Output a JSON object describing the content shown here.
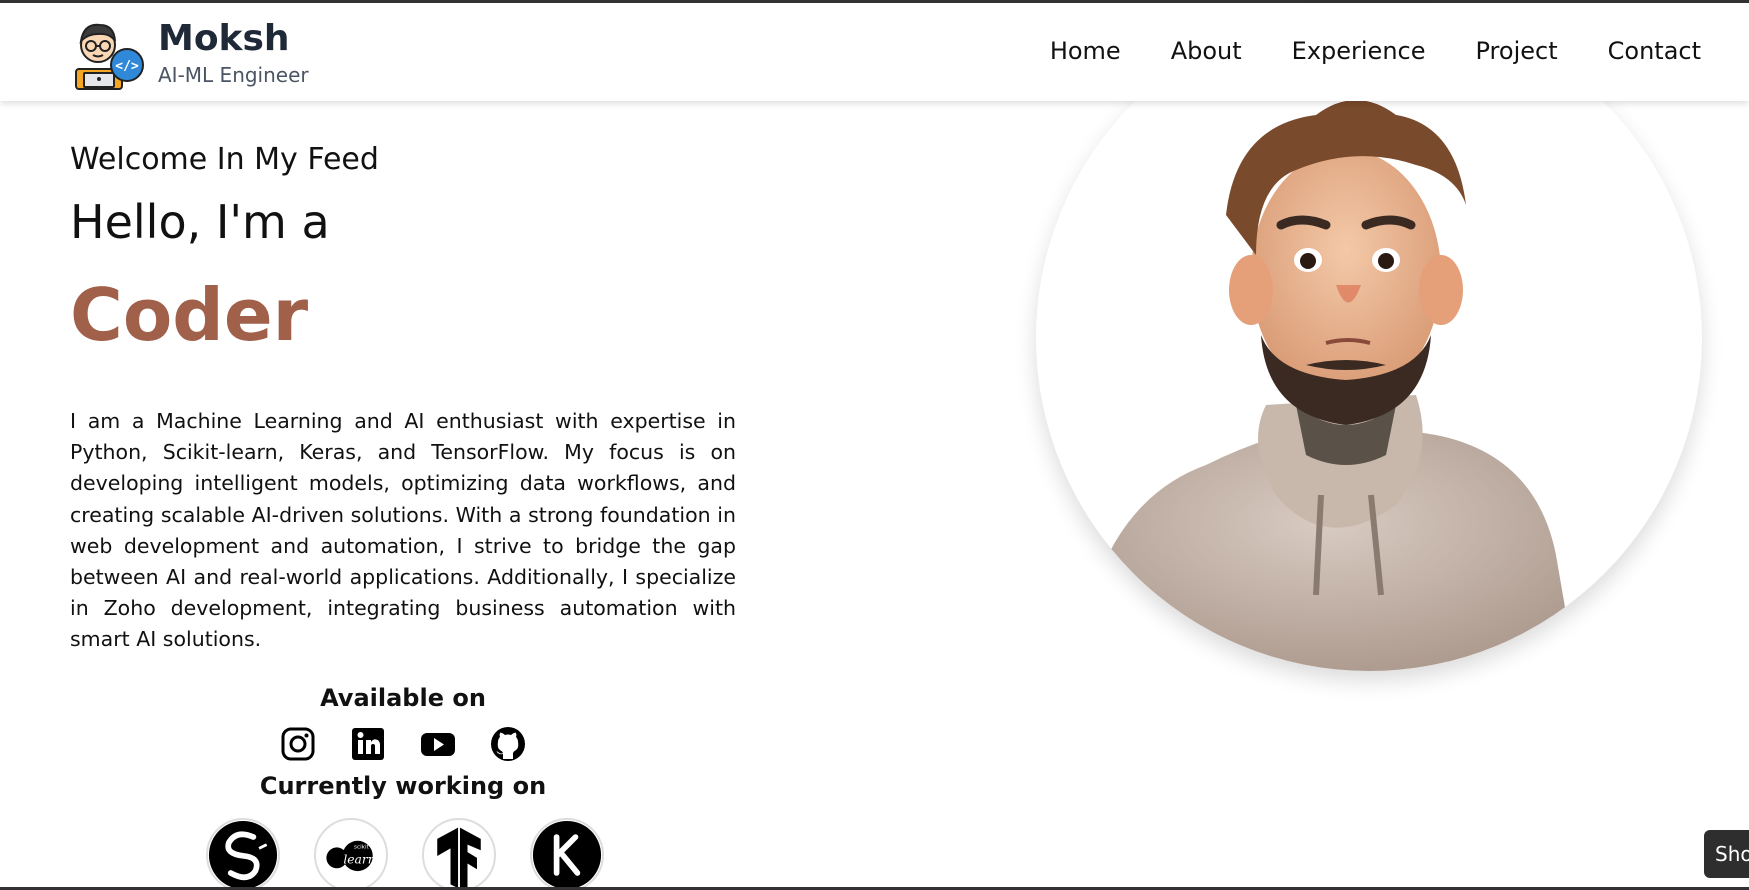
{
  "brand": {
    "name": "Moksh",
    "role": "AI-ML Engineer",
    "logo_icon": "developer-avatar-icon"
  },
  "nav": {
    "items": [
      "Home",
      "About",
      "Experience",
      "Project",
      "Contact"
    ]
  },
  "hero": {
    "welcome": "Welcome In My Feed",
    "hello": "Hello, I'm a",
    "role_word": "Coder",
    "role_color": "#a0604a",
    "bio": "I am a Machine Learning and AI enthusiast with expertise in Python, Scikit-learn, Keras, and TensorFlow. My focus is on developing intelligent models, optimizing data workflows, and creating scalable AI-driven solutions. With a strong foundation in web development and automation, I strive to bridge the gap between AI and real-world applications. Additionally, I specialize in Zoho development, integrating business automation with smart AI solutions."
  },
  "available": {
    "heading": "Available on",
    "icons": [
      "instagram-icon",
      "linkedin-icon",
      "youtube-icon",
      "github-icon"
    ]
  },
  "working": {
    "heading": "Currently working on",
    "icons": [
      "seaborn-icon",
      "scikit-learn-icon",
      "tensorflow-icon",
      "keras-icon"
    ]
  },
  "floating": {
    "show_label": "Sho"
  }
}
